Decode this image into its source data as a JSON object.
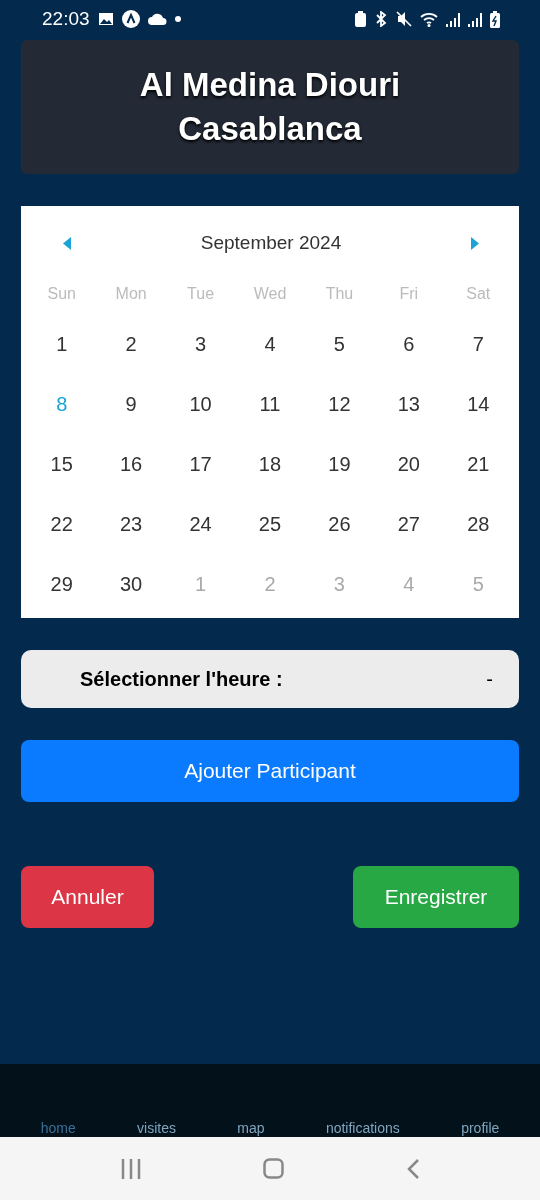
{
  "status_bar": {
    "time": "22:03"
  },
  "header": {
    "title": "Al Medina Diouri Casablanca"
  },
  "calendar": {
    "month": "September 2024",
    "weekdays": [
      "Sun",
      "Mon",
      "Tue",
      "Wed",
      "Thu",
      "Fri",
      "Sat"
    ],
    "days": [
      {
        "label": "1",
        "outside": false,
        "today": false
      },
      {
        "label": "2",
        "outside": false,
        "today": false
      },
      {
        "label": "3",
        "outside": false,
        "today": false
      },
      {
        "label": "4",
        "outside": false,
        "today": false
      },
      {
        "label": "5",
        "outside": false,
        "today": false
      },
      {
        "label": "6",
        "outside": false,
        "today": false
      },
      {
        "label": "7",
        "outside": false,
        "today": false
      },
      {
        "label": "8",
        "outside": false,
        "today": true
      },
      {
        "label": "9",
        "outside": false,
        "today": false
      },
      {
        "label": "10",
        "outside": false,
        "today": false
      },
      {
        "label": "11",
        "outside": false,
        "today": false
      },
      {
        "label": "12",
        "outside": false,
        "today": false
      },
      {
        "label": "13",
        "outside": false,
        "today": false
      },
      {
        "label": "14",
        "outside": false,
        "today": false
      },
      {
        "label": "15",
        "outside": false,
        "today": false
      },
      {
        "label": "16",
        "outside": false,
        "today": false
      },
      {
        "label": "17",
        "outside": false,
        "today": false
      },
      {
        "label": "18",
        "outside": false,
        "today": false
      },
      {
        "label": "19",
        "outside": false,
        "today": false
      },
      {
        "label": "20",
        "outside": false,
        "today": false
      },
      {
        "label": "21",
        "outside": false,
        "today": false
      },
      {
        "label": "22",
        "outside": false,
        "today": false
      },
      {
        "label": "23",
        "outside": false,
        "today": false
      },
      {
        "label": "24",
        "outside": false,
        "today": false
      },
      {
        "label": "25",
        "outside": false,
        "today": false
      },
      {
        "label": "26",
        "outside": false,
        "today": false
      },
      {
        "label": "27",
        "outside": false,
        "today": false
      },
      {
        "label": "28",
        "outside": false,
        "today": false
      },
      {
        "label": "29",
        "outside": false,
        "today": false
      },
      {
        "label": "30",
        "outside": false,
        "today": false
      },
      {
        "label": "1",
        "outside": true,
        "today": false
      },
      {
        "label": "2",
        "outside": true,
        "today": false
      },
      {
        "label": "3",
        "outside": true,
        "today": false
      },
      {
        "label": "4",
        "outside": true,
        "today": false
      },
      {
        "label": "5",
        "outside": true,
        "today": false
      }
    ]
  },
  "time_picker": {
    "label": "Sélectionner l'heure :",
    "value": "-"
  },
  "add_button": "Ajouter Participant",
  "cancel_button": "Annuler",
  "save_button": "Enregistrer",
  "bottom_nav": [
    {
      "label": "home",
      "selected": true
    },
    {
      "label": "visites",
      "selected": false
    },
    {
      "label": "map",
      "selected": false
    },
    {
      "label": "notifications",
      "selected": false
    },
    {
      "label": "profile",
      "selected": false
    }
  ]
}
